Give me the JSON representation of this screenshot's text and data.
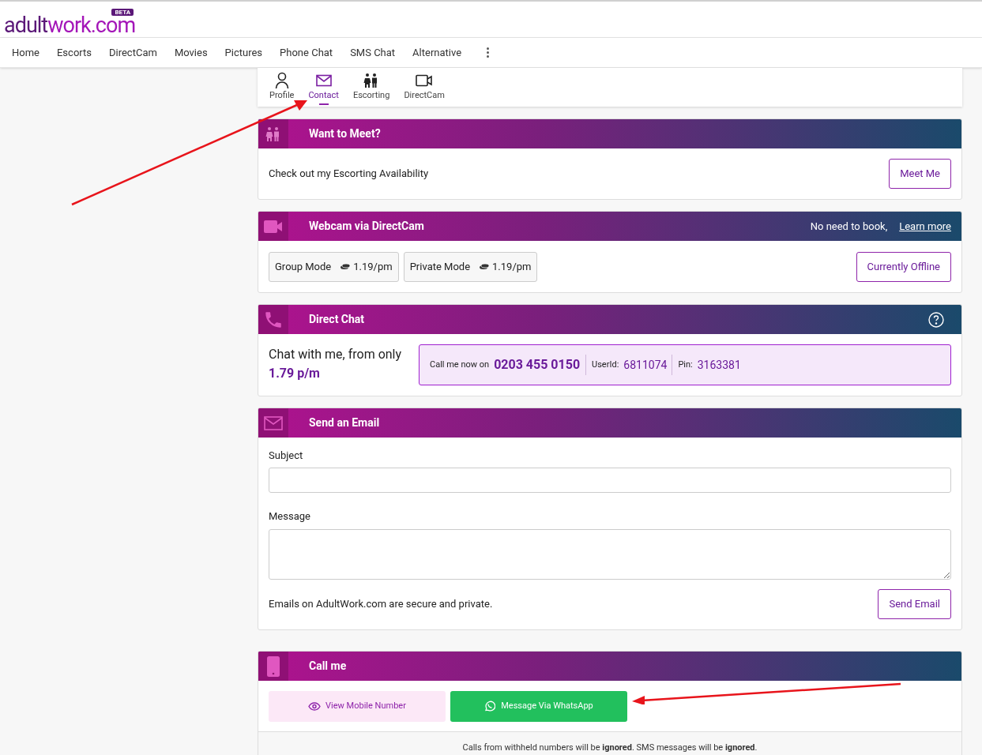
{
  "logo": {
    "first": "adult",
    "second": "work.com",
    "badge": "BETA"
  },
  "nav": {
    "items": [
      "Home",
      "Escorts",
      "DirectCam",
      "Movies",
      "Pictures",
      "Phone Chat",
      "SMS Chat",
      "Alternative"
    ]
  },
  "profile_tabs": [
    {
      "label": "Profile",
      "selected": false
    },
    {
      "label": "Contact",
      "selected": true
    },
    {
      "label": "Escorting",
      "selected": false
    },
    {
      "label": "DirectCam",
      "selected": false
    }
  ],
  "sections": [
    {
      "kind": "meet",
      "title": "Want to Meet?",
      "text": "Check out my Escorting Availability",
      "button": "Meet Me"
    },
    {
      "kind": "webcam",
      "title": "Webcam via DirectCam",
      "note": "No need to book,",
      "link": "Learn more",
      "modes": [
        {
          "label": "Group Mode",
          "price": "1.19/pm"
        },
        {
          "label": "Private Mode",
          "price": "1.19/pm"
        }
      ],
      "button": "Currently Offline"
    },
    {
      "kind": "chat",
      "title": "Direct Chat",
      "text": "Chat with me, from only",
      "rate": "1.79 p/m",
      "call_label": "Call me now on",
      "number": "0203 455 0150",
      "userid_label": "UserId:",
      "userid": "6811074",
      "pin_label": "Pin:",
      "pin": "3163381"
    },
    {
      "kind": "email",
      "title": "Send an Email",
      "subject_label": "Subject",
      "message_label": "Message",
      "note": "Emails on AdultWork.com are secure and private.",
      "button": "Send Email"
    },
    {
      "kind": "call",
      "title": "Call me",
      "view_button": "View Mobile Number",
      "whatsapp_button": "Message Via WhatsApp",
      "footer": "Calls from withheld numbers will be **ignored**. SMS messages will be **ignored**."
    }
  ]
}
